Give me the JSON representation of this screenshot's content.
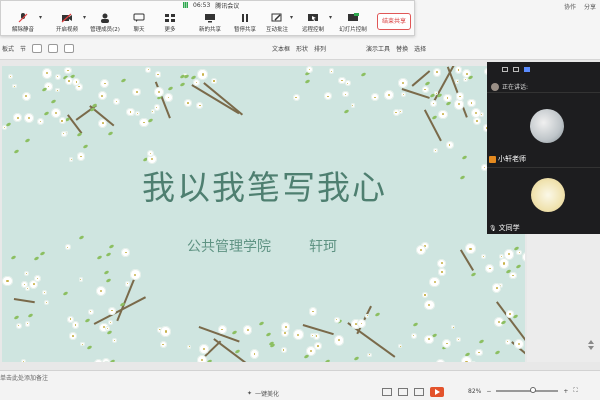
{
  "meeting": {
    "time": "06:53",
    "app_name": "腾讯会议",
    "tools": [
      {
        "label": "解除静音"
      },
      {
        "label": "开启视频"
      },
      {
        "label": "管理成员(2)"
      },
      {
        "label": "聊天"
      },
      {
        "label": "更多"
      },
      {
        "label": "新的共享"
      },
      {
        "label": "暂停共享"
      },
      {
        "label": "互动批注"
      },
      {
        "label": "远程控制"
      },
      {
        "label": "幻灯片控制"
      }
    ],
    "end_share": "结束共享"
  },
  "ribbon": {
    "row2_left": "板式",
    "row2_section": "节",
    "row2_items": [
      "文本框",
      "形状",
      "排列",
      "演示工具",
      "替换",
      "选择"
    ],
    "right": [
      "协作",
      "分享"
    ]
  },
  "slide": {
    "title": "我以我笔写我心",
    "department": "公共管理学院",
    "author": "轩珂"
  },
  "video_panel": {
    "speaking_label": "正在讲话:",
    "participants": [
      {
        "name": "小轩老师"
      },
      {
        "name": "文同学"
      }
    ]
  },
  "status_bar": {
    "notes_placeholder": "单击此处添加备注",
    "beautify_label": "一键美化",
    "zoom_percent": "82%"
  },
  "colors": {
    "slide_bg": "#cfe5e0",
    "title_color": "#4e7f70",
    "end_share": "#d83b3b",
    "play_button": "#e3532c"
  }
}
